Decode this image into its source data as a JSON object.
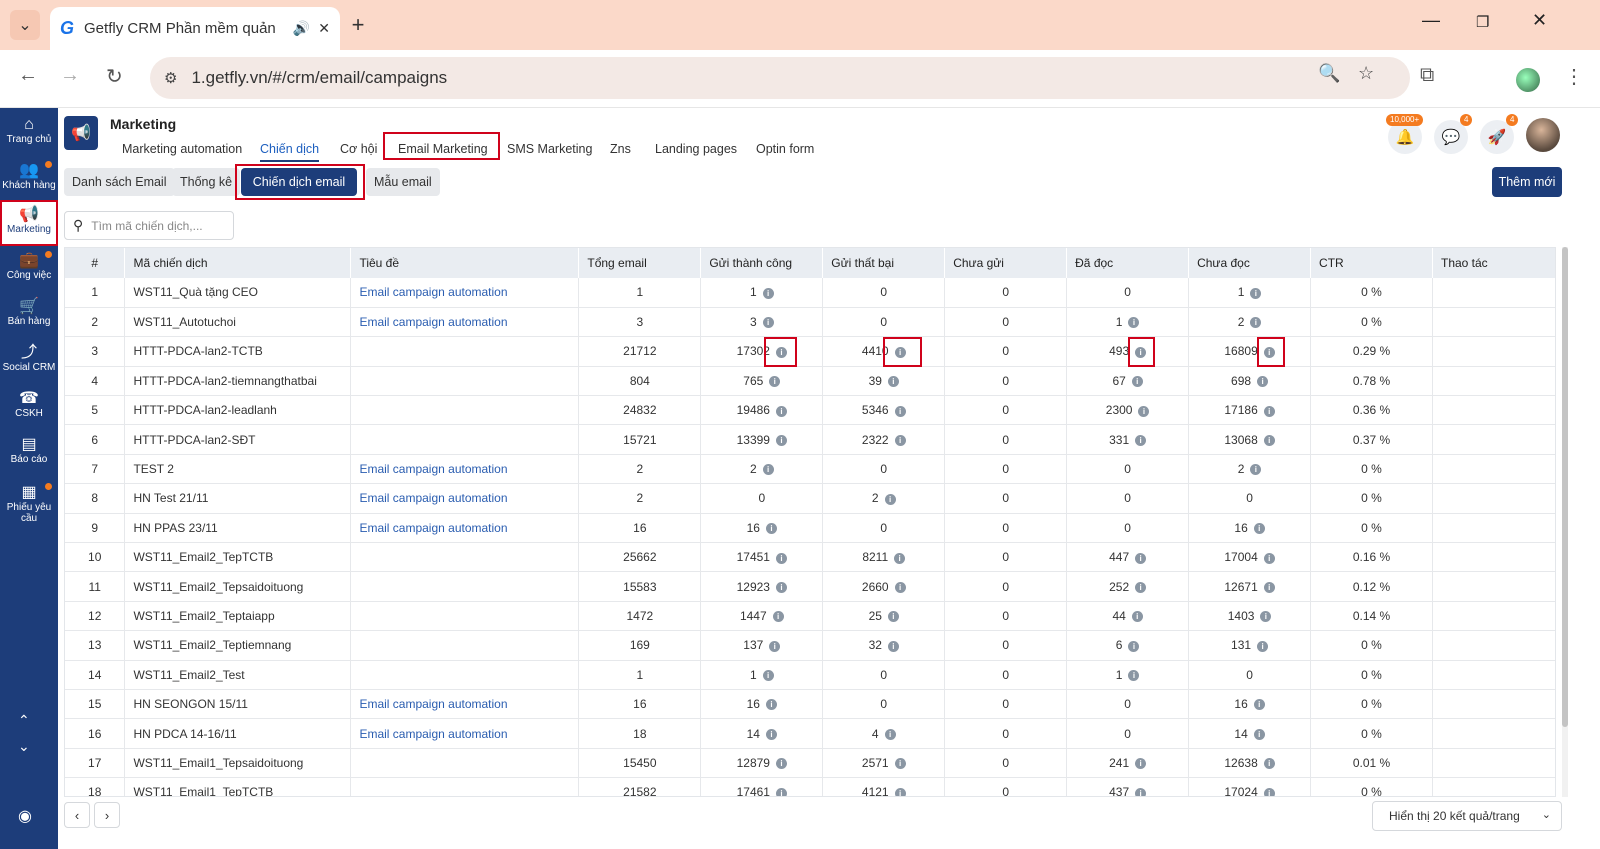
{
  "browser": {
    "tab_title": "Getfly CRM Phần mềm quản",
    "url": "1.getfly.vn/#/crm/email/campaigns",
    "new_tab_label": "+"
  },
  "sidebar": [
    {
      "id": "home",
      "label": "Trang chủ",
      "icon": "home-icon",
      "glyph": "⌂"
    },
    {
      "id": "customers",
      "label": "Khách hàng",
      "icon": "people-icon",
      "glyph": "👥",
      "dot": true
    },
    {
      "id": "marketing",
      "label": "Marketing",
      "icon": "megaphone-icon",
      "glyph": "📢",
      "active": true
    },
    {
      "id": "tasks",
      "label": "Công việc",
      "icon": "briefcase-icon",
      "glyph": "💼",
      "dot": true
    },
    {
      "id": "sales",
      "label": "Bán hàng",
      "icon": "cart-icon",
      "glyph": "🛒"
    },
    {
      "id": "social",
      "label": "Social CRM",
      "icon": "share-icon",
      "glyph": "⤴"
    },
    {
      "id": "cskh",
      "label": "CSKH",
      "icon": "phone-icon",
      "glyph": "☎"
    },
    {
      "id": "reports",
      "label": "Báo cáo",
      "icon": "report-icon",
      "glyph": "▤"
    },
    {
      "id": "requests",
      "label": "Phiếu yêu cầu",
      "icon": "document-icon",
      "glyph": "▦",
      "dot": true
    }
  ],
  "header": {
    "title": "Marketing",
    "nav": [
      "Marketing automation",
      "Chiến dịch",
      "Cơ hội",
      "Email Marketing",
      "SMS Marketing",
      "Zns",
      "Landing pages",
      "Optin form"
    ],
    "notif_badge": "10,000+",
    "chat_badge": "4",
    "rocket_badge": "4"
  },
  "subnav": {
    "buttons": [
      "Danh sách Email",
      "Thống kê",
      "Chiến dịch email",
      "Mẫu email"
    ],
    "add_label": "Thêm mới"
  },
  "search": {
    "placeholder": "Tìm mã chiến dịch,..."
  },
  "table": {
    "columns": [
      "#",
      "Mã chiến dịch",
      "Tiêu đề",
      "Tổng email",
      "Gửi thành công",
      "Gửi thất bại",
      "Chưa gửi",
      "Đã đọc",
      "Chưa đọc",
      "CTR",
      "Thao tác"
    ],
    "rows": [
      [
        "1",
        "WST11_Quà tặng CEO",
        "Email campaign automation",
        "1",
        "1",
        "0",
        "0",
        "0",
        "1",
        "0 %"
      ],
      [
        "2",
        "WST11_Autotuchoi",
        "Email campaign automation",
        "3",
        "3",
        "0",
        "0",
        "1",
        "2",
        "0 %"
      ],
      [
        "3",
        "HTTT-PDCA-lan2-TCTB",
        "",
        "21712",
        "17302",
        "4410",
        "0",
        "493",
        "16809",
        "0.29 %"
      ],
      [
        "4",
        "HTTT-PDCA-lan2-tiemnangthatbai",
        "",
        "804",
        "765",
        "39",
        "0",
        "67",
        "698",
        "0.78 %"
      ],
      [
        "5",
        "HTTT-PDCA-lan2-leadlanh",
        "",
        "24832",
        "19486",
        "5346",
        "0",
        "2300",
        "17186",
        "0.36 %"
      ],
      [
        "6",
        "HTTT-PDCA-lan2-SĐT",
        "",
        "15721",
        "13399",
        "2322",
        "0",
        "331",
        "13068",
        "0.37 %"
      ],
      [
        "7",
        "TEST 2",
        "Email campaign automation",
        "2",
        "2",
        "0",
        "0",
        "0",
        "2",
        "0 %"
      ],
      [
        "8",
        "HN Test 21/11",
        "Email campaign automation",
        "2",
        "0",
        "2",
        "0",
        "0",
        "0",
        "0 %"
      ],
      [
        "9",
        "HN PPAS 23/11",
        "Email campaign automation",
        "16",
        "16",
        "0",
        "0",
        "0",
        "16",
        "0 %"
      ],
      [
        "10",
        "WST11_Email2_TepTCTB",
        "",
        "25662",
        "17451",
        "8211",
        "0",
        "447",
        "17004",
        "0.16 %"
      ],
      [
        "11",
        "WST11_Email2_Tepsaidoituong",
        "",
        "15583",
        "12923",
        "2660",
        "0",
        "252",
        "12671",
        "0.12 %"
      ],
      [
        "12",
        "WST11_Email2_Teptaiapp",
        "",
        "1472",
        "1447",
        "25",
        "0",
        "44",
        "1403",
        "0.14 %"
      ],
      [
        "13",
        "WST11_Email2_Teptiemnang",
        "",
        "169",
        "137",
        "32",
        "0",
        "6",
        "131",
        "0 %"
      ],
      [
        "14",
        "WST11_Email2_Test",
        "",
        "1",
        "1",
        "0",
        "0",
        "1",
        "0",
        "0 %"
      ],
      [
        "15",
        "HN SEONGON 15/11",
        "Email campaign automation",
        "16",
        "16",
        "0",
        "0",
        "0",
        "16",
        "0 %"
      ],
      [
        "16",
        "HN PDCA 14-16/11",
        "Email campaign automation",
        "18",
        "14",
        "4",
        "0",
        "0",
        "14",
        "0 %"
      ],
      [
        "17",
        "WST11_Email1_Tepsaidoituong",
        "",
        "15450",
        "12879",
        "2571",
        "0",
        "241",
        "12638",
        "0.01 %"
      ],
      [
        "18",
        "WST11_Email1_TepTCTB",
        "",
        "21582",
        "17461",
        "4121",
        "0",
        "437",
        "17024",
        "0 %"
      ]
    ]
  },
  "pagination": {
    "prev": "‹",
    "next": "›",
    "per_page_label": "Hiển thị 20 kết quả/trang"
  }
}
